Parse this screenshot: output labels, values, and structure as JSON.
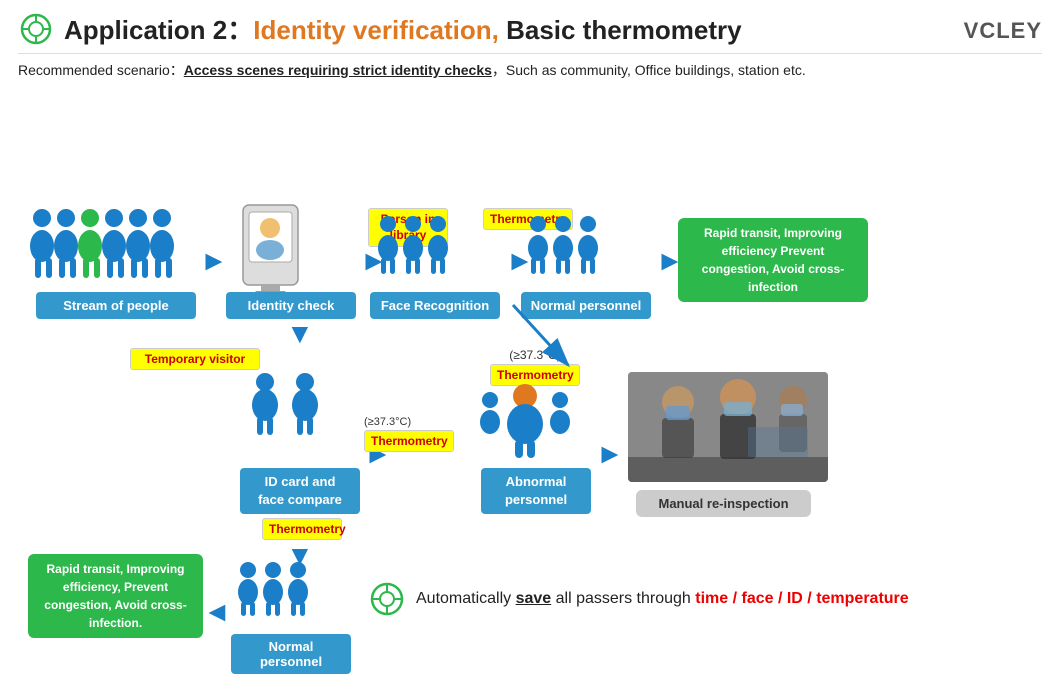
{
  "header": {
    "app_label": "Application 2：",
    "identity_label": "Identity verification,",
    "basic_label": " Basic thermometry",
    "logo": "VCLEY"
  },
  "scenario": {
    "prefix": "Recommended scenario：",
    "underline": "Access scenes requiring strict identity checks",
    "suffix": "，Such as community, Office buildings, station etc."
  },
  "flow_top": {
    "stream": "Stream of people",
    "identity": "Identity check",
    "face": "Face Recognition",
    "normal": "Normal personnel",
    "person_library": "Person in\nlibrary",
    "thermometry1": "Thermometry",
    "green_top": "Rapid transit, Improving efficiency\nPrevent congestion, Avoid cross-infection"
  },
  "flow_bottom": {
    "temp_visitor": "Temporary visitor",
    "id_compare": "ID card and\nface compare",
    "thermometry2": "Thermometry",
    "temp_label": "(≥37.3°C)\nThermometry",
    "temp_label2": "(≥37.3°C)",
    "thermometry3": "Thermometry",
    "abnormal": "Abnormal\npersonnel",
    "manual": "Manual re-inspection",
    "green_bottom": "Rapid transit,\nImproving efficiency,\nPrevent congestion,\nAvoid cross-infection.",
    "normal2": "Normal personnel"
  },
  "bottom_text": {
    "prefix": "Automatically ",
    "save": "save",
    "middle": " all passers through ",
    "highlight": "time / face / ID / temperature"
  }
}
